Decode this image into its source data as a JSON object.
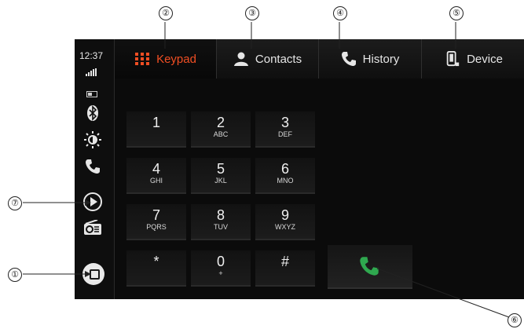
{
  "status": {
    "time": "12:37"
  },
  "tabs": [
    {
      "label": "Keypad",
      "icon": "keypad-grid-icon",
      "active": true
    },
    {
      "label": "Contacts",
      "icon": "contact-person-icon",
      "active": false
    },
    {
      "label": "History",
      "icon": "phone-history-icon",
      "active": false
    },
    {
      "label": "Device",
      "icon": "phone-device-icon",
      "active": false
    }
  ],
  "keys": [
    {
      "digit": "1",
      "sub": ""
    },
    {
      "digit": "2",
      "sub": "ABC"
    },
    {
      "digit": "3",
      "sub": "DEF"
    },
    {
      "digit": "4",
      "sub": "GHI"
    },
    {
      "digit": "5",
      "sub": "JKL"
    },
    {
      "digit": "6",
      "sub": "MNO"
    },
    {
      "digit": "7",
      "sub": "PQRS"
    },
    {
      "digit": "8",
      "sub": "TUV"
    },
    {
      "digit": "9",
      "sub": "WXYZ"
    },
    {
      "digit": "*",
      "sub": ""
    },
    {
      "digit": "0",
      "sub": "+"
    },
    {
      "digit": "#",
      "sub": ""
    }
  ],
  "side_icons": [
    "bluetooth-icon",
    "brightness-icon",
    "phone-icon",
    "play-icon",
    "radio-icon",
    "home-icon"
  ],
  "callouts": {
    "n1": "①",
    "n2": "②",
    "n3": "③",
    "n4": "④",
    "n5": "⑤",
    "n6": "⑥",
    "n7": "⑦"
  },
  "colors": {
    "accent": "#f04e23",
    "call_green": "#2fa84f",
    "background": "#0b0b0b"
  }
}
